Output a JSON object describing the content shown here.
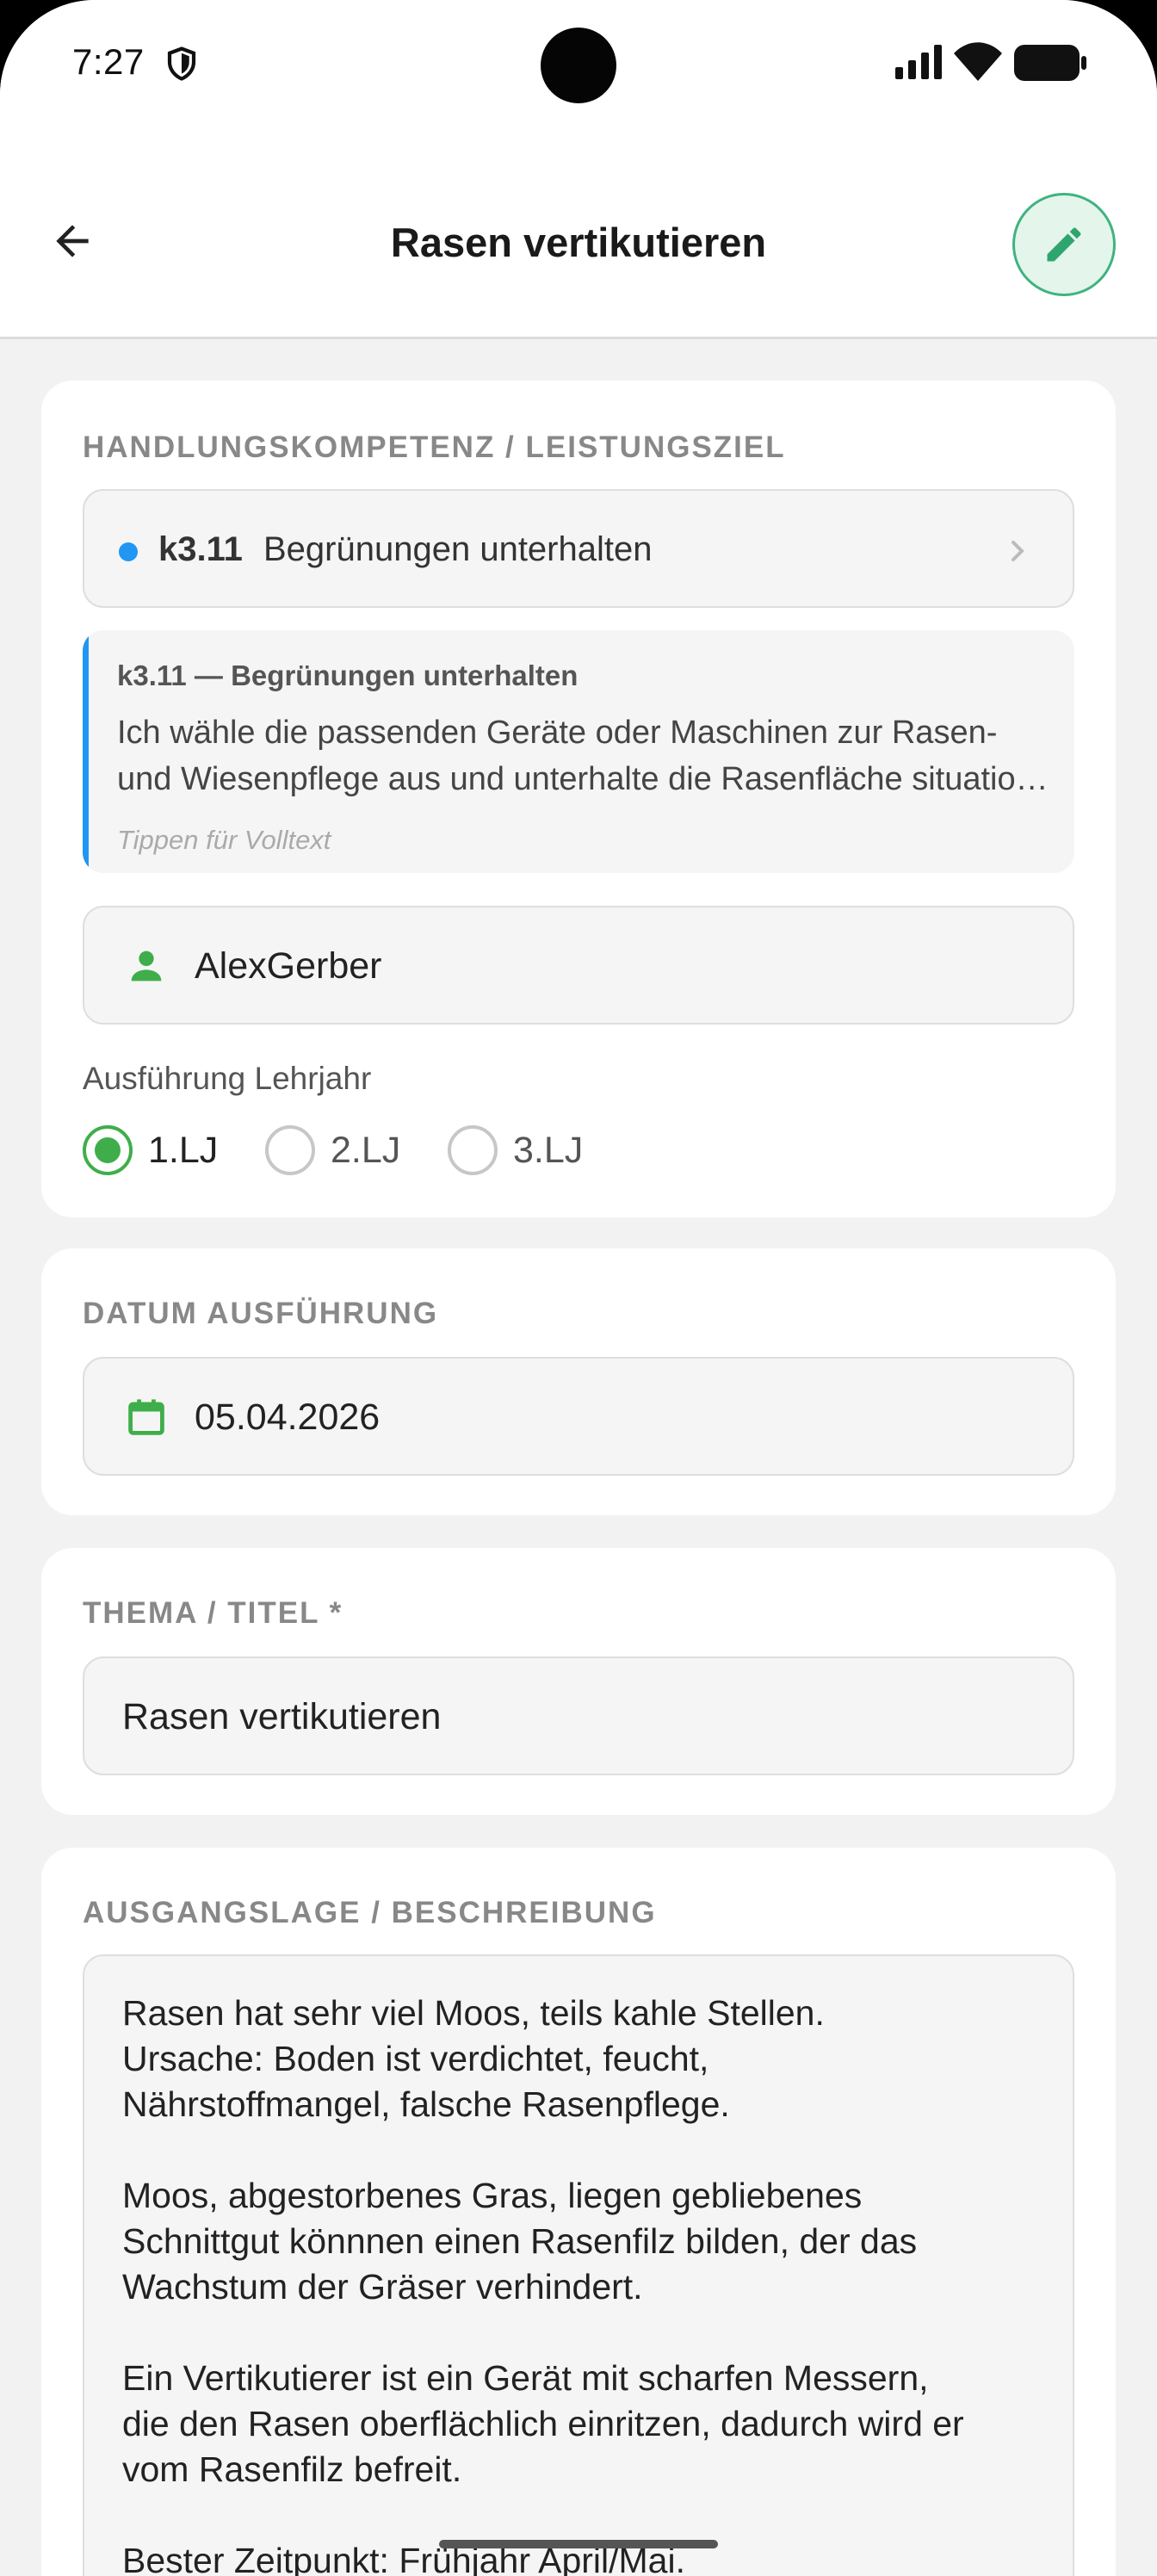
{
  "status_bar": {
    "time": "7:27"
  },
  "app_bar": {
    "title": "Rasen vertikutieren"
  },
  "competence_section": {
    "label": "HANDLUNGSKOMPETENZ / LEISTUNGSZIEL",
    "code": "k3.11",
    "name": "Begrünungen unterhalten",
    "detail_title": "k3.11 — Begrünungen unterhalten",
    "detail_line1": "Ich wähle die passenden Geräte oder Maschinen zur Rasen-",
    "detail_line2": "und Wiesenpflege aus und unterhalte die Rasenfläche situationsgerecht.",
    "detail_hint": "Tippen für Volltext",
    "person": "AlexGerber",
    "year_label": "Ausführung Lehrjahr",
    "year_options": [
      "1.LJ",
      "2.LJ",
      "3.LJ"
    ],
    "year_selected": "1.LJ"
  },
  "date_section": {
    "label": "DATUM AUSFÜHRUNG",
    "value": "05.04.2026"
  },
  "title_section": {
    "label": "THEMA / TITEL *",
    "value": "Rasen vertikutieren"
  },
  "description_section": {
    "label": "AUSGANGSLAGE / BESCHREIBUNG",
    "text": "Rasen hat sehr viel Moos, teils kahle Stellen.\nUrsache: Boden ist verdichtet, feucht,\nNährstoffmangel, falsche Rasenpflege.\n\nMoos, abgestorbenes Gras, liegen gebliebenes\nSchnittgut könnnen einen Rasenfilz bilden, der das\nWachstum der Gräser verhindert.\n\nEin Vertikutierer ist ein Gerät mit scharfen Messern,\ndie den Rasen oberflächlich einritzen, dadurch wird er\nvom Rasenfilz befreit.\n\nBester Zeitpunkt: Frühjahr April/Mai."
  },
  "colors": {
    "accent": "#3fb37f",
    "green": "#3fae4a",
    "blue": "#2196f3"
  },
  "icons": [
    "shield-icon",
    "signal-icon",
    "wifi-icon",
    "battery-icon",
    "back-arrow-icon",
    "pencil-icon",
    "chevron-right-icon",
    "person-icon",
    "calendar-icon"
  ]
}
